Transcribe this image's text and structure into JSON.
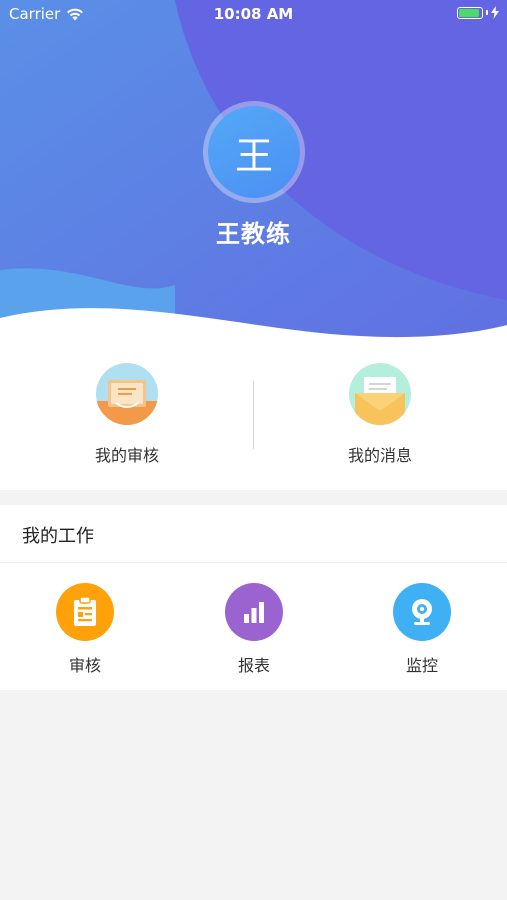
{
  "status_bar": {
    "carrier": "Carrier",
    "time": "10:08 AM",
    "icons": [
      "wifi-icon",
      "battery-icon",
      "charging-bolt-icon"
    ]
  },
  "profile": {
    "avatar_text": "王",
    "name": "王教练"
  },
  "quick_links": [
    {
      "label": "我的审核",
      "icon": "review-card-icon"
    },
    {
      "label": "我的消息",
      "icon": "message-envelope-icon"
    }
  ],
  "work_section": {
    "title": "我的工作",
    "items": [
      {
        "label": "审核",
        "icon": "clipboard-icon",
        "color": "#ffa10a"
      },
      {
        "label": "报表",
        "icon": "bar-chart-icon",
        "color": "#9b63d0"
      },
      {
        "label": "监控",
        "icon": "webcam-icon",
        "color": "#3fb0f4"
      }
    ]
  },
  "colors": {
    "header_gradient_start": "#5d8be6",
    "header_gradient_end": "#6366e3",
    "background": "#f3f3f3"
  }
}
